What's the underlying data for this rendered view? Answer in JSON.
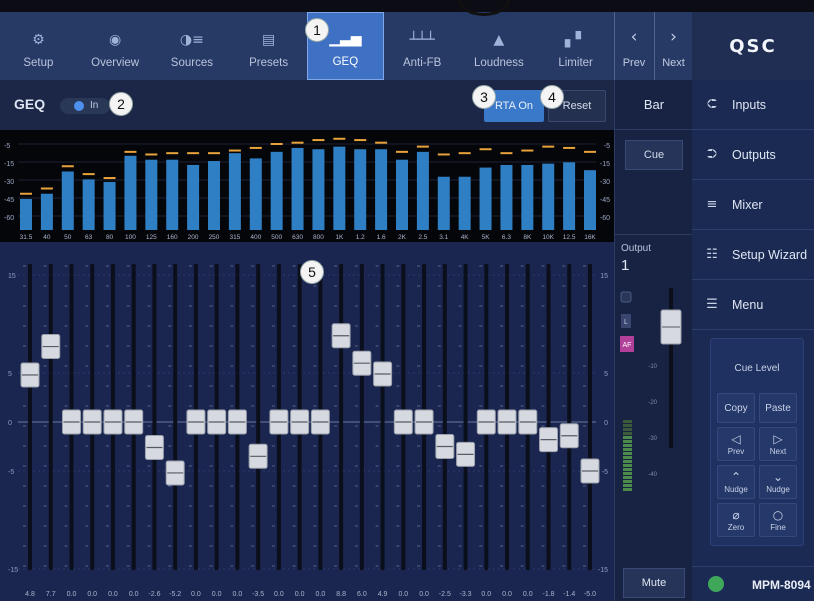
{
  "tabs": [
    {
      "label": "Setup",
      "icon": "gear-icon"
    },
    {
      "label": "Overview",
      "icon": "eye-icon"
    },
    {
      "label": "Sources",
      "icon": "sources-icon"
    },
    {
      "label": "Presets",
      "icon": "presets-icon"
    },
    {
      "label": "GEQ",
      "icon": "geq-icon",
      "active": true
    },
    {
      "label": "Anti-FB",
      "icon": "anti-feedback-icon"
    },
    {
      "label": "Loudness",
      "icon": "loudness-icon"
    },
    {
      "label": "Limiter",
      "icon": "limiter-icon"
    }
  ],
  "nav": {
    "prev": "Prev",
    "next": "Next"
  },
  "brand": "QSC",
  "geq": {
    "title": "GEQ",
    "toggle_label": "In",
    "toggle_on": true,
    "rta_button": "RTA On",
    "reset_button": "Reset"
  },
  "rta": {
    "scale_labels": [
      "-5",
      "-15",
      "-30",
      "-45",
      "-60"
    ],
    "frequencies": [
      "31.5",
      "40",
      "50",
      "63",
      "80",
      "100",
      "125",
      "160",
      "200",
      "250",
      "315",
      "400",
      "500",
      "630",
      "800",
      "1K",
      "1.2",
      "1.6",
      "2K",
      "2.5",
      "3.1",
      "4K",
      "5K",
      "6.3",
      "8K",
      "10K",
      "12.5",
      "16K"
    ],
    "bar_levels_db": [
      -47,
      -43,
      -26,
      -32,
      -34,
      -14,
      -17,
      -17,
      -21,
      -18,
      -12,
      -16,
      -11,
      -8,
      -9,
      -7,
      -9,
      -9,
      -17,
      -11,
      -30,
      -30,
      -23,
      -21,
      -21,
      -20,
      -19,
      -25
    ],
    "peak_levels_db": [
      -43,
      -39,
      -22,
      -28,
      -31,
      -11,
      -13,
      -12,
      -12,
      -12,
      -10,
      -8,
      -5,
      -4,
      -2,
      -1,
      -2,
      -4,
      -11,
      -7,
      -13,
      -12,
      -9,
      -12,
      -10,
      -7,
      -8,
      -11
    ]
  },
  "faders": {
    "scale_labels": [
      "15",
      "5",
      "0",
      "-5",
      "-15"
    ],
    "gains_db": [
      4.8,
      7.7,
      0.0,
      0.0,
      0.0,
      0.0,
      -2.6,
      -5.2,
      0.0,
      0.0,
      0.0,
      -3.5,
      0.0,
      0.0,
      0.0,
      8.8,
      6.0,
      4.9,
      0.0,
      0.0,
      -2.5,
      -3.3,
      0.0,
      0.0,
      0.0,
      -1.8,
      -1.4,
      -5.0
    ],
    "value_labels": [
      "4.8",
      "7.7",
      "0.0",
      "0.0",
      "0.0",
      "0.0",
      "-2.6",
      "-5.2",
      "0.0",
      "0.0",
      "0.0",
      "-3.5",
      "0.0",
      "0.0",
      "0.0",
      "8.8",
      "6.0",
      "4.9",
      "0.0",
      "0.0",
      "-2.5",
      "-3.3",
      "0.0",
      "0.0",
      "0.0",
      "-1.8",
      "-1.4",
      "-5.0"
    ]
  },
  "strip": {
    "bar_label": "Bar",
    "cue_button": "Cue",
    "output_label": "Output",
    "output_number": "1",
    "link_badge": "link-icon",
    "l_badge": "L",
    "af_badge": "AF",
    "meter_scale": [
      "-10",
      "-20",
      "-30",
      "-40"
    ],
    "mute_button": "Mute"
  },
  "menu": [
    {
      "label": "Inputs",
      "icon": "inputs-icon"
    },
    {
      "label": "Outputs",
      "icon": "outputs-icon"
    },
    {
      "label": "Mixer",
      "icon": "mixer-icon"
    },
    {
      "label": "Setup Wizard",
      "icon": "setup-wizard-icon"
    },
    {
      "label": "Menu",
      "icon": "menu-icon"
    }
  ],
  "cue_panel": {
    "title": "Cue Level",
    "copy": "Copy",
    "paste": "Paste",
    "prev": "Prev",
    "next": "Next",
    "nudge_up": "Nudge",
    "nudge_down": "Nudge",
    "zero": "Zero",
    "fine": "Fine"
  },
  "device": {
    "name": "MPM-8094",
    "status_color": "#3ea75a"
  },
  "callouts": [
    "1",
    "2",
    "3",
    "4",
    "5"
  ],
  "colors": {
    "accent": "#3e70c4",
    "rta_bar": "#2f7fc4",
    "rta_peak": "#e8a33a",
    "fader_track": "#0b0f1c"
  }
}
